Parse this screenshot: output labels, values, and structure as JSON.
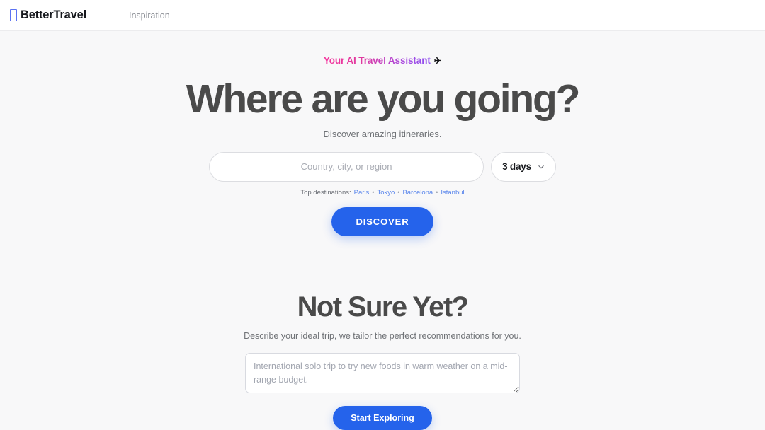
{
  "header": {
    "brand": {
      "glyph_icon": "tofu-box-icon",
      "name": "BetterTravel",
      "glyph_color": "#5b72f2"
    },
    "nav": [
      {
        "label": "Inspiration"
      }
    ]
  },
  "hero": {
    "eyebrow": "Your AI Travel Assistant",
    "eyebrow_icon": "✈",
    "title": "Where are you going?",
    "subtitle": "Discover amazing itineraries.",
    "search": {
      "value": "",
      "placeholder": "Country, city, or region"
    },
    "duration": {
      "selected": "3 days",
      "chevron_icon": "chevron-down-icon"
    },
    "top_destinations": {
      "label": "Top destinations:",
      "separator": "•",
      "items": [
        "Paris",
        "Tokyo",
        "Barcelona",
        "Istanbul"
      ]
    },
    "cta": "DISCOVER"
  },
  "ideas": {
    "title": "Not Sure Yet?",
    "subtitle": "Describe your ideal trip, we tailor the perfect recommendations for you.",
    "textarea": {
      "value": "",
      "placeholder": "International solo trip to try new foods in warm weather on a mid-range budget."
    },
    "cta": "Start Exploring"
  },
  "colors": {
    "accent_blue": "#2563eb",
    "link_blue": "#5a86ec",
    "gradient_start": "#f5359e",
    "gradient_end": "#8c4ef0",
    "page_bg": "#f8f8f9",
    "heading_gray": "#4a4a4a"
  }
}
